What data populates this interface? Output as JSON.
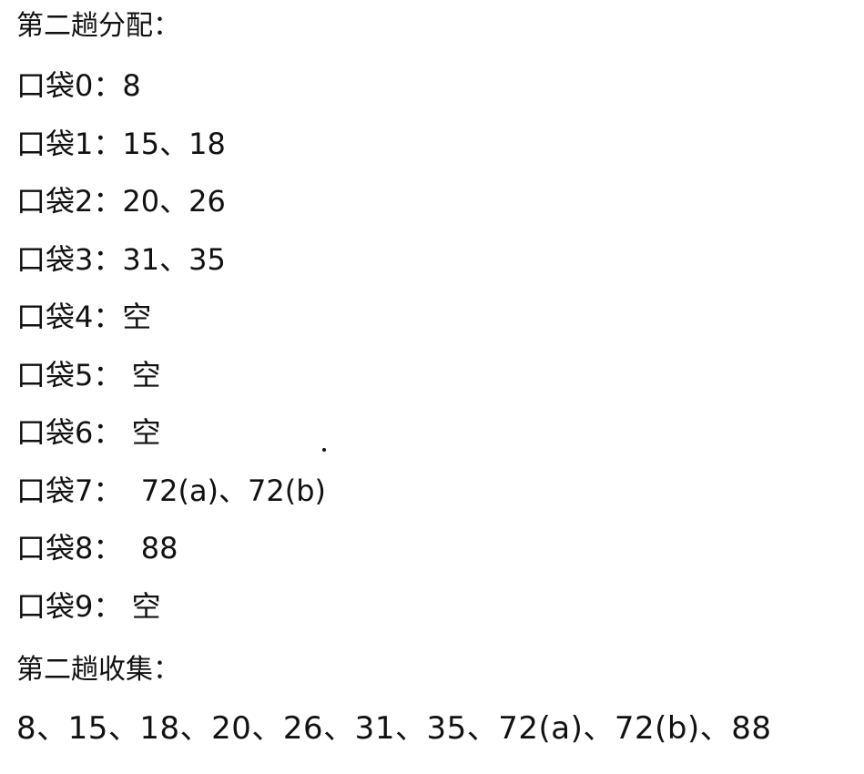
{
  "pass2": {
    "distribution_title": "第二趟分配：",
    "pockets": [
      {
        "label": "口袋0",
        "sep": "：",
        "value": "8"
      },
      {
        "label": "口袋1",
        "sep": "：",
        "value": "15、18"
      },
      {
        "label": "口袋2",
        "sep": "：",
        "value": "20、26"
      },
      {
        "label": "口袋3",
        "sep": "：",
        "value": "31、35"
      },
      {
        "label": "口袋4",
        "sep": "：",
        "value": "空"
      },
      {
        "label": "口袋5",
        "sep": "： ",
        "value": "空"
      },
      {
        "label": "口袋6",
        "sep": "： ",
        "value": "空"
      },
      {
        "label": "口袋7",
        "sep": "：  ",
        "value": "72(a)、72(b)"
      },
      {
        "label": "口袋8",
        "sep": "：  ",
        "value": "88"
      },
      {
        "label": "口袋9",
        "sep": "： ",
        "value": "空"
      }
    ],
    "collection_title": "第二趟收集：",
    "collection_result": "8、15、18、20、26、31、35、72(a)、72(b)、88"
  }
}
